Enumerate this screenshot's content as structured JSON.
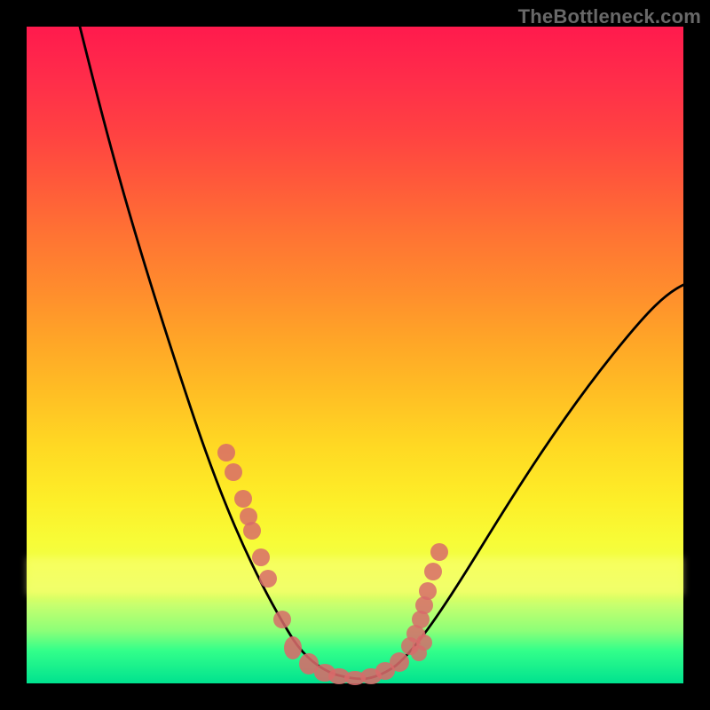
{
  "attribution": "TheBottleneck.com",
  "chart_data": {
    "type": "line",
    "title": "",
    "xlabel": "",
    "ylabel": "",
    "xlim": [
      0,
      100
    ],
    "ylim": [
      0,
      100
    ],
    "description": "V-shaped curve over a vertical red-to-green gradient; minimum (≈0) near x≈45–50, left arm rises steeply toward y≈100 at x≈8, right arm rises to y≈55 at x≈100.",
    "series": [
      {
        "name": "curve",
        "x": [
          8,
          12,
          16,
          20,
          24,
          28,
          32,
          35,
          38,
          41,
          44,
          47,
          50,
          53,
          56,
          60,
          65,
          70,
          76,
          83,
          90,
          96,
          100
        ],
        "y": [
          100,
          88,
          77,
          66,
          55,
          44,
          33,
          24,
          16,
          9,
          4,
          1,
          0,
          1,
          3,
          6,
          11,
          17,
          24,
          32,
          40,
          48,
          55
        ]
      }
    ],
    "points": {
      "name": "scatter-overlay",
      "x": [
        30,
        31,
        33,
        34,
        34.5,
        36,
        37,
        40,
        44,
        46,
        48,
        50,
        52,
        54,
        56,
        57,
        58,
        58.5,
        59,
        60,
        61
      ],
      "y": [
        38,
        35,
        30,
        27,
        25,
        22,
        19,
        10,
        3,
        1.5,
        1,
        0.8,
        1.2,
        2.5,
        4,
        6,
        8,
        10,
        12,
        15,
        18
      ]
    }
  }
}
